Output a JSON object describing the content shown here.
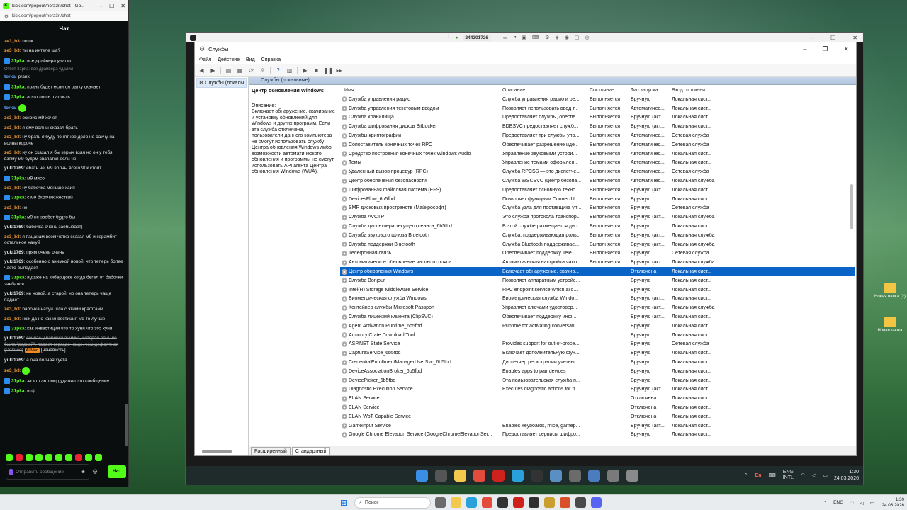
{
  "chat": {
    "tab_title": "kick.com/popout/norz3n/chat - Go...",
    "url": "kick.com/popout/norz3n/chat",
    "header": "Чат",
    "messages": [
      {
        "user": "ze3_b3",
        "color": "#f59c33",
        "text": "по пк"
      },
      {
        "user": "ze3_b3",
        "color": "#f59c33",
        "text": "ты на интеле ща?"
      },
      {
        "user": "31pka",
        "color": "#53fc18",
        "badge": true,
        "text": "все драйвера удалил"
      },
      {
        "reply": "Ответ 31pka: все драйвера удалил"
      },
      {
        "user": "torka",
        "color": "#5aa7ff",
        "text": "prank"
      },
      {
        "user": "31pka",
        "color": "#53fc18",
        "badge": true,
        "text": "пранк будет если он ратку скачает"
      },
      {
        "user": "31pka",
        "color": "#53fc18",
        "badge": true,
        "text": "а это лишь шалость"
      },
      {
        "user": "torka",
        "color": "#5aa7ff",
        "emote": true,
        "text": ""
      },
      {
        "user": "ze3_b3",
        "color": "#f59c33",
        "text": "оснрис м9 хочет"
      },
      {
        "user": "ze3_b3",
        "color": "#f59c33",
        "text": "я ему волны сказал брать"
      },
      {
        "user": "ze3_b3",
        "color": "#f59c33",
        "text": "ну брать я буду понятное дело но байчу на волны короче"
      },
      {
        "user": "ze3_b3",
        "color": "#f59c33",
        "text": "ну он сказал я бы керыч взял но он у тебя взяму м9 будем свапатся если че"
      },
      {
        "user": "yuki1769",
        "color": "#e4e4e4",
        "text": "ебать че, м9 волны всего 90к стоит"
      },
      {
        "user": "31pka",
        "color": "#53fc18",
        "badge": true,
        "text": "м9 мясо"
      },
      {
        "user": "ze3_b3",
        "color": "#f59c33",
        "text": "ну бабочка меньше хайп"
      },
      {
        "user": "31pka",
        "color": "#53fc18",
        "badge": true,
        "text": "с м9 бхопчик жесткий"
      },
      {
        "user": "ze3_b3",
        "color": "#f59c33",
        "text": "не"
      },
      {
        "user": "31pka",
        "color": "#53fc18",
        "badge": true,
        "text": "м9 не заебет будто бы"
      },
      {
        "user": "yuki1769",
        "color": "#e4e4e4",
        "text": "бабочка очень заебывает)"
      },
      {
        "user": "ze3_b3",
        "color": "#f59c33",
        "text": "я пацанам всем четко сказал м9 и керамбит остальное нахуй"
      },
      {
        "user": "yuki1769",
        "color": "#e4e4e4",
        "text": "прям очень очень"
      },
      {
        "user": "yuki1769",
        "color": "#e4e4e4",
        "text": "особенно с анимкой новой, что теперь более часто выпадает"
      },
      {
        "user": "31pka",
        "color": "#53fc18",
        "badge": true,
        "text": "я даже на киберщоке когда бегал от бабочки заебался"
      },
      {
        "user": "yuki1769",
        "color": "#e4e4e4",
        "text": "не новой, а старой, но она теперь чаще падает"
      },
      {
        "user": "ze3_b3",
        "color": "#f59c33",
        "text": "бабочка нахуй шла с этими крафтами"
      },
      {
        "user": "ze3_b3",
        "color": "#f59c33",
        "text": "нож да но как инвестиция м9 то лучше"
      },
      {
        "user": "31pka",
        "color": "#53fc18",
        "badge": true,
        "text": "как инвестиция что то хуня что это хуня"
      },
      {
        "user": "yuki1769",
        "color": "#e4e4e4",
        "deleted": true,
        "text": "сейчас у бабочки анимка, которая раньше была \"редкой\", падает гораздо чаще, чем дефолтная (Deleted)",
        "mod": "AI Mod",
        "tail": "[ненависть]"
      },
      {
        "user": "yuki1769",
        "color": "#e4e4e4",
        "text": "а она полная хуета"
      },
      {
        "user": "ze3_b3",
        "color": "#f59c33",
        "emote": true,
        "text": ""
      },
      {
        "user": "31pka",
        "color": "#53fc18",
        "badge": true,
        "text": "за что автомод удалил это сообщение"
      },
      {
        "user": "31pka",
        "color": "#53fc18",
        "badge": true,
        "text": "втф"
      }
    ],
    "input_placeholder": "Отправить сообщение",
    "send_label": "Чат"
  },
  "remote": {
    "session_id": "244201726"
  },
  "services": {
    "window_title": "Службы",
    "menu": [
      "Файл",
      "Действие",
      "Вид",
      "Справка"
    ],
    "tree_item": "Службы (локалы",
    "panel_header": "Службы (локальные)",
    "selected_title": "Центр обновления Windows",
    "desc_label": "Описание:",
    "desc_text": "Включает обнаружение, скачивание и установку обновлений для Windows и других программ. Если эта служба отключена, пользователи данного компьютера не смогут использовать службу Центра обновления Windows либо возможности автоматического обновления и программы не смогут использовать API агента Центра обновления Windows (WUA).",
    "columns": [
      "Имя",
      "Описание",
      "Состояние",
      "Тип запуска",
      "Вход от имени"
    ],
    "rows": [
      [
        "Служба управления радио",
        "Служба управления радио и ре...",
        "Выполняется",
        "Вручную",
        "Локальная сист..."
      ],
      [
        "Служба управления текстовым вводом",
        "Позволяет использовать ввод т...",
        "Выполняется",
        "Автоматичес...",
        "Локальная сист..."
      ],
      [
        "Служба хранилища",
        "Предоставляет службы, обеспе...",
        "Выполняется",
        "Вручную (акт...",
        "Локальная сист..."
      ],
      [
        "Служба шифрования дисков BitLocker",
        "BDESVC предоставляет служб...",
        "Выполняется",
        "Вручную (акт...",
        "Локальная сист..."
      ],
      [
        "Службы криптографии",
        "Предоставляет три службы упр...",
        "Выполняется",
        "Автоматичес...",
        "Сетевая служба"
      ],
      [
        "Сопоставитель конечных точек RPC",
        "Обеспечивает разрешение иде...",
        "Выполняется",
        "Автоматичес...",
        "Сетевая служба"
      ],
      [
        "Средство построения конечных точек Windows Audio",
        "Управление звуковыми устрой...",
        "Выполняется",
        "Автоматичес...",
        "Локальная сист..."
      ],
      [
        "Темы",
        "Управление темами оформлен...",
        "Выполняется",
        "Автоматичес...",
        "Локальная сист..."
      ],
      [
        "Удаленный вызов процедур (RPC)",
        "Служба RPCSS — это диспетче...",
        "Выполняется",
        "Автоматичес...",
        "Сетевая служба"
      ],
      [
        "Центр обеспечения безопасности",
        "Служба WSCSVC (центр безопа...",
        "Выполняется",
        "Автоматичес...",
        "Локальная служба"
      ],
      [
        "Шифрованная файловая система (EFS)",
        "Предоставляет основную техно...",
        "Выполняется",
        "Вручную (акт...",
        "Локальная сист..."
      ],
      [
        "DevicesFlow_6b5fbd",
        "Позволяет функциям ConnectU...",
        "Выполняется",
        "Вручную",
        "Локальная сист..."
      ],
      [
        "SMP дисковых пространств (Майкрософт)",
        "Служба узла для поставщика уп...",
        "Выполняется",
        "Вручную",
        "Сетевая служба"
      ],
      [
        "Служба AVCTP",
        "Это служба протокола транспор...",
        "Выполняется",
        "Вручную (акт...",
        "Локальная служба"
      ],
      [
        "Служба диспетчера текущего сеанса_6b5fbd",
        "В этой службе размещается дис...",
        "Выполняется",
        "Вручную",
        "Локальная сист..."
      ],
      [
        "Служба звукового шлюза Bluetooth",
        "Служба, поддерживающая роль...",
        "Выполняется",
        "Вручную (акт...",
        "Локальная служба"
      ],
      [
        "Служба поддержки Bluetooth",
        "Служба Bluetooth поддерживае...",
        "Выполняется",
        "Вручную (акт...",
        "Локальная служба"
      ],
      [
        "Телефонная связь",
        "Обеспечивает поддержку Tele...",
        "Выполняется",
        "Вручную",
        "Сетевая служба"
      ],
      [
        "Автоматическое обновление часового пояса",
        "Автоматическая настройка часо...",
        "Выполняется",
        "Вручную (акт...",
        "Локальная служба"
      ],
      [
        "Центр обновления Windows",
        "Включает обнаружение, скачив...",
        "",
        "Отключена",
        "Локальная сист..."
      ],
      [
        "Служба Bonjour",
        "Позволяет аппаратным устройс...",
        "",
        "Вручную",
        "Локальная сист..."
      ],
      [
        "Intel(R) Storage Middleware Service",
        "RPC endpoint service which allo...",
        "",
        "Вручную",
        "Локальная сист..."
      ],
      [
        "Биометрическая служба Windows",
        "Биометрическая служба Windo...",
        "",
        "Вручную (акт...",
        "Локальная сист..."
      ],
      [
        "Контейнер службы Microsoft Passport",
        "Управляет ключами удостовер...",
        "",
        "Вручную (акт...",
        "Локальная служба"
      ],
      [
        "Служба лицензий клиента (ClipSVC)",
        "Обеспечивает поддержку инф...",
        "",
        "Вручную (акт...",
        "Локальная сист..."
      ],
      [
        "Agent Activation Runtime_6b5fbd",
        "Runtime for activating conversati...",
        "",
        "Вручную",
        "Локальная сист..."
      ],
      [
        "Armoury Crate Download Tool",
        "",
        "",
        "Вручную",
        "Локальная сист..."
      ],
      [
        "ASP.NET State Service",
        "Provides support for out-of-proce...",
        "",
        "Вручную",
        "Сетевая служба"
      ],
      [
        "CaptureService_6b5fbd",
        "Включает дополнительную фун...",
        "",
        "Вручную",
        "Локальная сист..."
      ],
      [
        "CredentialEnrollmentManagerUserSvc_6b5fbd",
        "Диспетчер регистрации учетны...",
        "",
        "Вручную",
        "Локальная сист..."
      ],
      [
        "DeviceAssociationBroker_6b5fbd",
        "Enables apps to pair devices",
        "",
        "Вручную",
        "Локальная сист..."
      ],
      [
        "DevicePicker_6b5fbd",
        "Эта пользовательская служба п...",
        "",
        "Вручную",
        "Локальная сист..."
      ],
      [
        "Diagnostic Execution Service",
        "Executes diagnostic actions for tr...",
        "",
        "Вручную (акт...",
        "Локальная сист..."
      ],
      [
        "ELAN Service",
        "",
        "",
        "Отключена",
        "Локальная сист..."
      ],
      [
        "ELAN Service",
        "",
        "",
        "Отключена",
        "Локальная сист..."
      ],
      [
        "ELAN WoT Capable Service",
        "",
        "",
        "Отключена",
        "Локальная сист..."
      ],
      [
        "GameInput Service",
        "Enables keyboards, mice, gamep...",
        "",
        "Вручную (акт...",
        "Локальная сист..."
      ],
      [
        "Google Chrome Elevation Service (GoogleChromeElevationSer...",
        "Предоставляет сервисы шифро...",
        "",
        "Вручную",
        "Локальная сист..."
      ]
    ],
    "selected_index": 19,
    "tabs": [
      "Расширенный",
      "Стандартный"
    ]
  },
  "remote_taskbar": {
    "lang1": "ENG",
    "lang2": "INTL",
    "en_badge": "En",
    "time": "1:30",
    "date": "24.03.2026"
  },
  "desktop_icons": [
    {
      "label": "Новая папка (2)"
    },
    {
      "label": "Новая папка"
    }
  ],
  "host_taskbar": {
    "search_placeholder": "Поиск",
    "lang": "ENG",
    "time": "1:30",
    "date": "24.03.2026"
  }
}
